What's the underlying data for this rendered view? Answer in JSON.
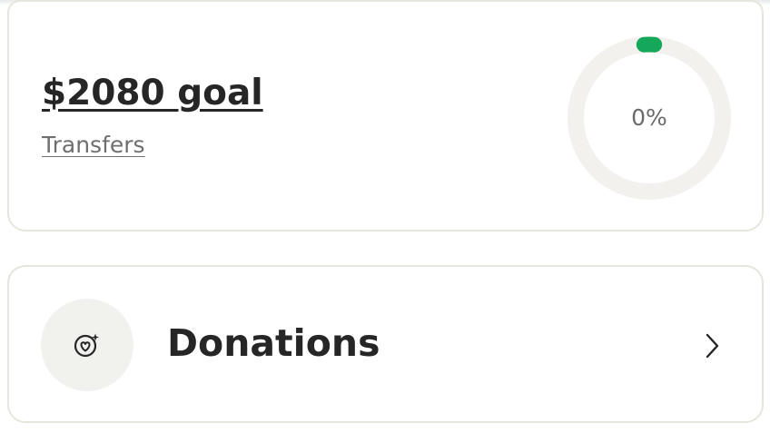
{
  "goal_card": {
    "title": "$2080 goal",
    "subtitle": "Transfers",
    "progress": {
      "percent_label": "0%",
      "fraction": 0.0,
      "track_color": "#f2f1ee",
      "fill_color": "#16a85a"
    }
  },
  "donations_card": {
    "label": "Donations",
    "icon": "heart-target-sparkle-icon",
    "trailing_icon": "chevron-right-icon",
    "icon_bg_color": "#f1f1ee"
  },
  "colors": {
    "text_primary": "#262626",
    "text_secondary": "#6f6f6f",
    "card_border": "#e6e6df",
    "accent": "#16a85a"
  }
}
